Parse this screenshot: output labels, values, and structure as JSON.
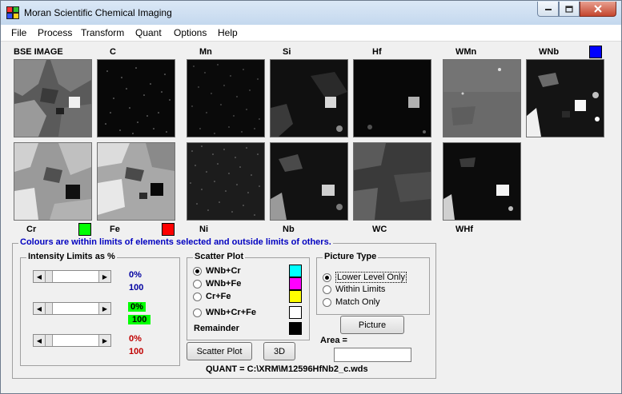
{
  "window": {
    "title": "Moran Scientific Chemical Imaging"
  },
  "menu": [
    "File",
    "Process",
    "Transform",
    "Quant",
    "Options",
    "Help"
  ],
  "headers_row1": [
    "BSE IMAGE",
    "C",
    "Mn",
    "Si",
    "Hf",
    "WMn",
    "WNb"
  ],
  "labels_row2": [
    "Cr",
    "Fe",
    "Ni",
    "Nb",
    "WC",
    "WHf"
  ],
  "colours": {
    "blue": "#0000ff",
    "green": "#00ff00",
    "red": "#ff0000",
    "cyan": "#00ffff",
    "magenta": "#ff00ff",
    "yellow": "#ffff00",
    "white": "#ffffff",
    "black": "#000000"
  },
  "main_group": {
    "legend": "Colours are within limits of elements selected and outside limits of others."
  },
  "intensity": {
    "legend": "Intensity Limits as %",
    "rows": [
      {
        "low": "0%",
        "high": "100",
        "color": "#0000a0",
        "highlight": ""
      },
      {
        "low": "0%",
        "high": "100",
        "color": "#000000",
        "highlight": "#00ff00"
      },
      {
        "low": "0%",
        "high": "100",
        "color": "#c00000",
        "highlight": ""
      }
    ]
  },
  "scatter": {
    "legend": "Scatter Plot",
    "options": [
      "WNb+Cr",
      "WNb+Fe",
      "Cr+Fe",
      "WNb+Cr+Fe"
    ],
    "selected": "WNb+Cr",
    "remainder": "Remainder",
    "btn_scatter": "Scatter Plot",
    "btn_3d": "3D"
  },
  "picture_type": {
    "legend": "Picture Type",
    "options": [
      "Lower Level Only",
      "Within Limits",
      "Match Only"
    ],
    "selected": "Lower Level Only",
    "btn": "Picture"
  },
  "area": {
    "label": "Area =",
    "value": ""
  },
  "quant_file": "QUANT = C:\\XRM\\M12596HfNb2_c.wds"
}
